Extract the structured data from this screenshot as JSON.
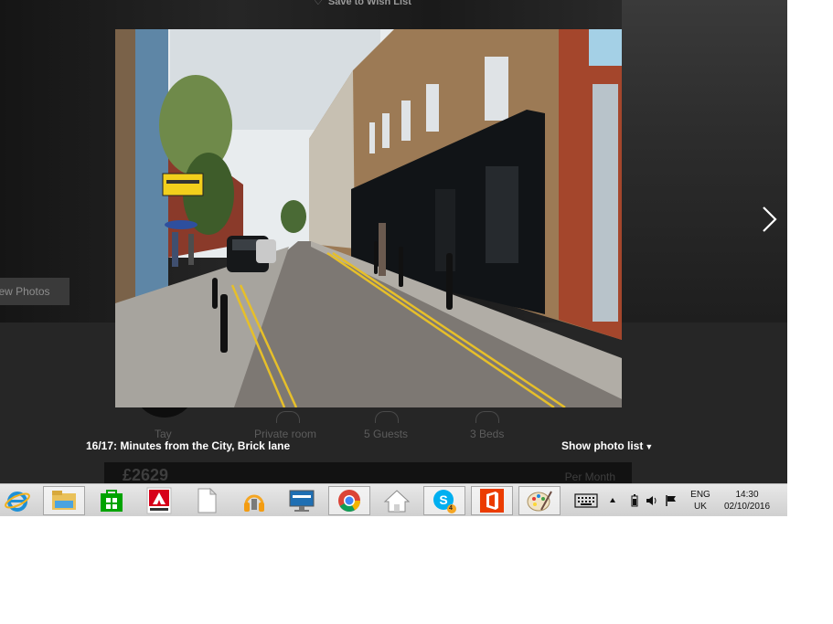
{
  "background_page": {
    "wishlist_label": "Save to Wish List",
    "view_photos_label": "View Photos",
    "amenities": [
      {
        "label": "Tay"
      },
      {
        "label": "Private room"
      },
      {
        "label": "5 Guests"
      },
      {
        "label": "3 Beds"
      }
    ],
    "price": "£2629",
    "price_period": "Per Month"
  },
  "viewer": {
    "caption": "16/17: Minutes from the City, Brick lane",
    "show_photo_list_label": "Show photo list",
    "next_icon": "chevron-right-icon"
  },
  "taskbar": {
    "apps": [
      {
        "name": "internet-explorer",
        "label": "Internet Explorer",
        "active": false
      },
      {
        "name": "file-explorer",
        "label": "File Explorer",
        "active": true
      },
      {
        "name": "store",
        "label": "Store",
        "active": false
      },
      {
        "name": "adobe",
        "label": "Adobe",
        "active": false
      },
      {
        "name": "document",
        "label": "Document",
        "active": false
      },
      {
        "name": "headphones-app",
        "label": "Music",
        "active": false
      },
      {
        "name": "lenovo",
        "label": "lenovo",
        "active": false
      },
      {
        "name": "chrome",
        "label": "Google Chrome",
        "active": true
      },
      {
        "name": "home",
        "label": "Home",
        "active": false
      },
      {
        "name": "skype",
        "label": "Skype",
        "active": true,
        "badge": "4"
      },
      {
        "name": "office",
        "label": "Office",
        "active": true
      },
      {
        "name": "paint",
        "label": "Paint",
        "active": true
      }
    ],
    "tray": {
      "lang_line1": "ENG",
      "lang_line2": "UK",
      "time": "14:30",
      "date": "02/10/2016"
    }
  },
  "colors": {
    "overlay": "#1c1c1c",
    "taskbar": "#d9d9d9",
    "chrome_red": "#db4437",
    "chrome_green": "#0f9d58",
    "chrome_yellow": "#f4b400",
    "chrome_blue": "#4285f4",
    "skype_blue": "#00aff0",
    "office_orange": "#eb3c00",
    "store_green": "#00a300",
    "adobe_red": "#d7001a"
  }
}
